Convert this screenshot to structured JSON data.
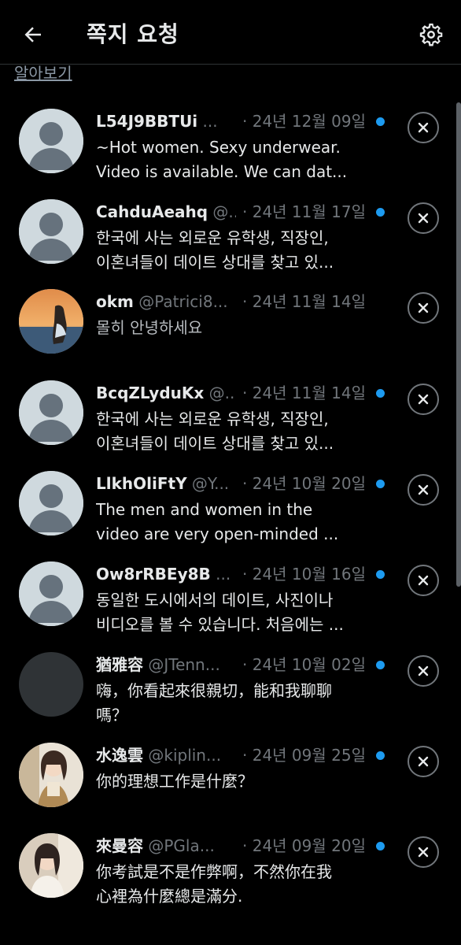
{
  "header": {
    "title": "쪽지 요청",
    "back_icon": "arrow-left-icon",
    "settings_icon": "gear-icon"
  },
  "learn_more": "알아보기",
  "colors": {
    "unread_dot": "#1d9bf0",
    "background": "#000000",
    "secondary_text": "#71767b"
  },
  "requests": [
    {
      "name": "L54J9BBTUi",
      "handle": "...",
      "date": "· 24년 12월 09일",
      "unread": true,
      "avatar": "default",
      "message": [
        "~Hot women. Sexy underwear.",
        "Video is available. We can dat..."
      ]
    },
    {
      "name": "CahduAeahq",
      "handle": "@...",
      "date": "· 24년 11월 17일",
      "unread": true,
      "avatar": "default",
      "message": [
        "한국에 사는 외로운 유학생, 직장인,",
        "이혼녀들이 데이트 상대를 찾고 있..."
      ]
    },
    {
      "name": "okm",
      "handle": "@Patrici8...",
      "date": "· 24년 11월 14일",
      "unread": false,
      "avatar": "sunset-photo",
      "message": [
        "몰히 안녕하세요"
      ]
    },
    {
      "name": "BcqZLyduKx",
      "handle": "@...",
      "date": "· 24년 11월 14일",
      "unread": true,
      "avatar": "default",
      "message": [
        "한국에 사는 외로운 유학생, 직장인,",
        "이혼녀들이 데이트 상대를 찾고 있..."
      ]
    },
    {
      "name": "LlkhOliFtY",
      "handle": "@Y...",
      "date": "· 24년 10월 20일",
      "unread": true,
      "avatar": "default",
      "message": [
        "The men and women in the",
        "video are very open-minded ..."
      ]
    },
    {
      "name": "Ow8rRBEy8B",
      "handle": "...",
      "date": "· 24년 10월 16일",
      "unread": true,
      "avatar": "default",
      "message": [
        "동일한 도시에서의 데이트, 사진이나",
        "비디오를 볼 수 있습니다. 처음에는 ..."
      ]
    },
    {
      "name": "猶雅容",
      "handle": "@JTenn...",
      "date": "· 24년 10월 02일",
      "unread": true,
      "avatar": "dark",
      "message": [
        "嗨，你看起來很親切，能和我聊聊",
        "嗎？"
      ]
    },
    {
      "name": "水逸雲",
      "handle": "@kiplin...",
      "date": "· 24년 09월 25일",
      "unread": true,
      "avatar": "girl-photo",
      "message": [
        "你的理想工作是什麼？"
      ]
    },
    {
      "name": "來曼容",
      "handle": "@PGla...",
      "date": "· 24년 09월 20일",
      "unread": true,
      "avatar": "girl-photo-2",
      "message": [
        "你考試是不是作弊啊，不然你在我",
        "心裡為什麼總是滿分."
      ]
    }
  ]
}
